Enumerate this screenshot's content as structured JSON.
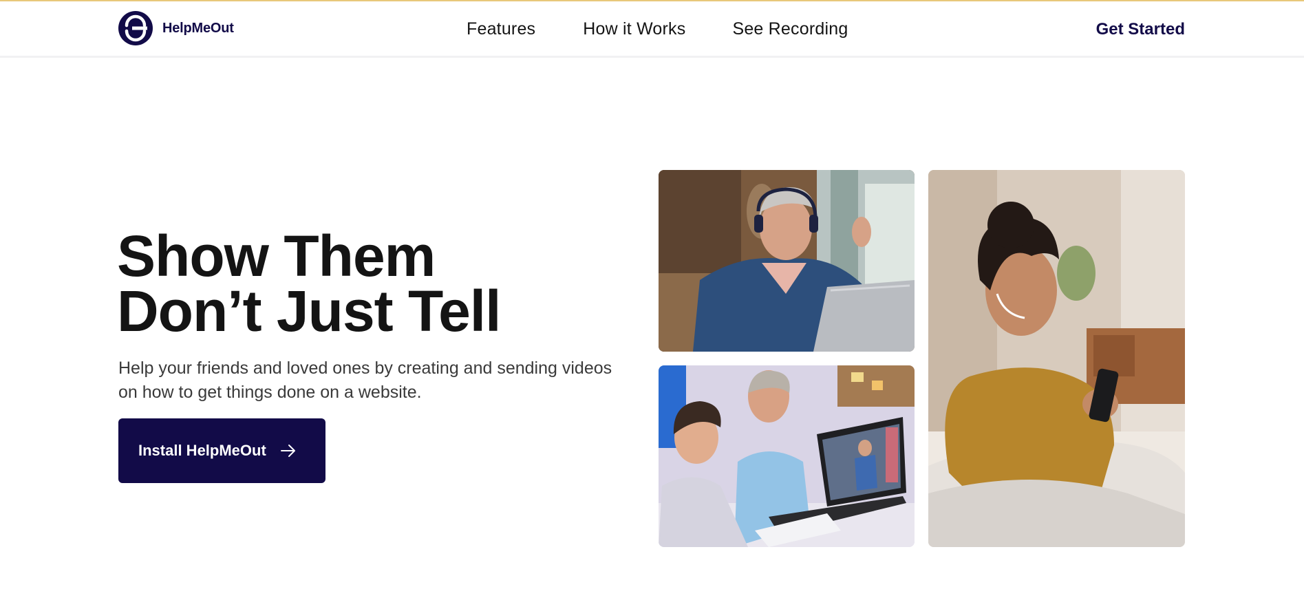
{
  "brand": {
    "name": "HelpMeOut",
    "color": "#120b48",
    "accent": "#e8c87a"
  },
  "nav": {
    "links": [
      "Features",
      "How it Works",
      "See Recording"
    ],
    "cta": "Get Started"
  },
  "hero": {
    "title_line1": "Show Them",
    "title_line2": "Don’t Just Tell",
    "subtitle": "Help your friends and loved ones by creating and sending videos on how to get things done on a website.",
    "button_label": "Install HelpMeOut",
    "button_icon": "arrow-right-icon"
  },
  "gallery": [
    {
      "name": "woman-with-headphones-at-laptop"
    },
    {
      "name": "man-and-boy-watching-laptop"
    },
    {
      "name": "woman-smiling-at-phone"
    }
  ]
}
